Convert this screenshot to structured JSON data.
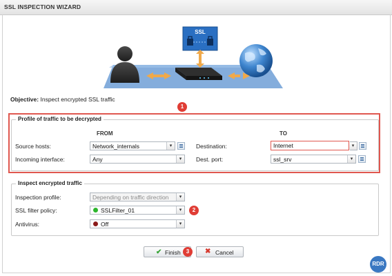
{
  "window": {
    "title": "SSL INSPECTION WIZARD"
  },
  "illustration": {
    "ssl_label": "SSL"
  },
  "objective": {
    "label": "Objective:",
    "text": "Inspect encrypted SSL traffic"
  },
  "profile_section": {
    "legend": "Profile of traffic to be decrypted",
    "col_from": "FROM",
    "col_to": "TO",
    "source_hosts": {
      "label": "Source hosts:",
      "value": "Network_internals"
    },
    "destination": {
      "label": "Destination:",
      "value": "Internet"
    },
    "incoming_interface": {
      "label": "Incoming interface:",
      "value": "Any"
    },
    "dest_port": {
      "label": "Dest. port:",
      "value": "ssl_srv"
    }
  },
  "inspect_section": {
    "legend": "Inspect encrypted traffic",
    "inspection_profile": {
      "label": "Inspection profile:",
      "value": "Depending on traffic direction"
    },
    "ssl_filter_policy": {
      "label": "SSL filter policy:",
      "value": "SSLFilter_01",
      "status_color": "#2cb52c"
    },
    "antivirus": {
      "label": "Antivirus:",
      "value": "Off",
      "status_color": "#8b1a1a"
    }
  },
  "buttons": {
    "finish": "Finish",
    "cancel": "Cancel"
  },
  "annotations": {
    "badge1": "1",
    "badge2": "2",
    "badge3": "3"
  },
  "watermark": "RDR",
  "colors": {
    "highlight": "#e0574f",
    "badge": "#e03d35",
    "accent_blue": "#3a78c2"
  }
}
